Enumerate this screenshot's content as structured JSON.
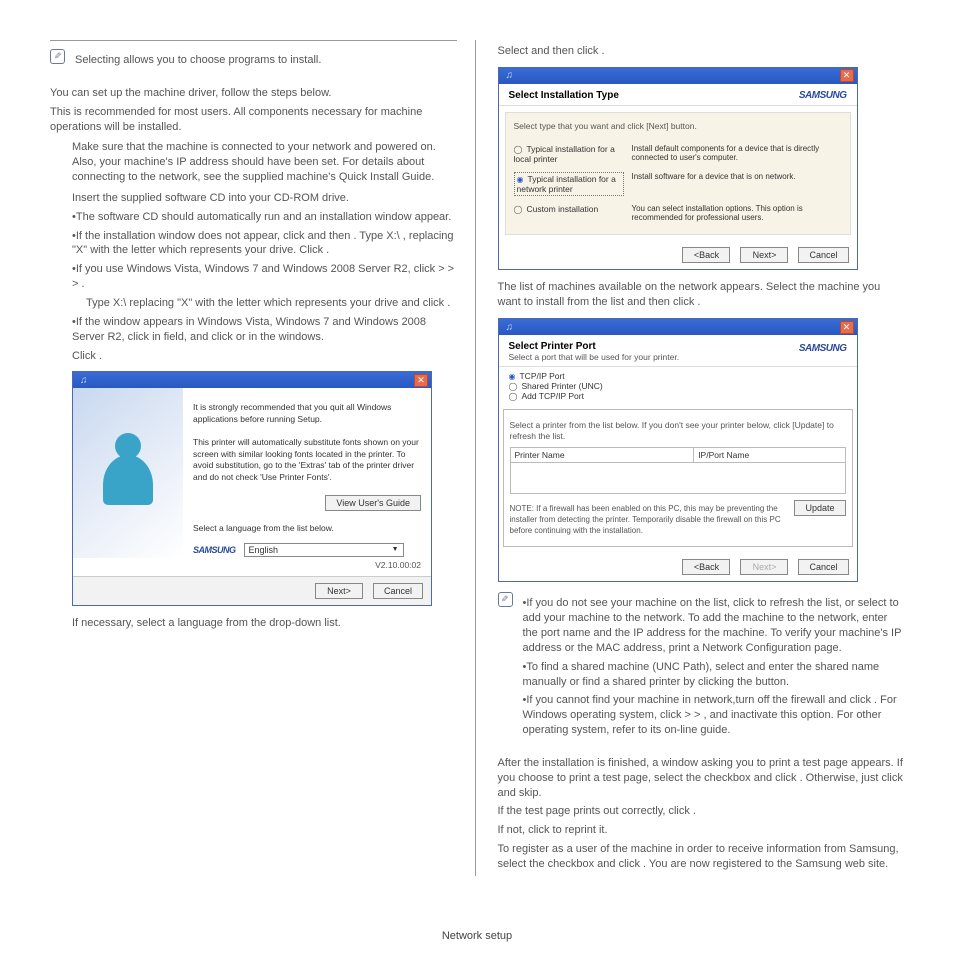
{
  "left": {
    "note1": "Selecting                    allows you to choose programs to install.",
    "p1": "You can set up the machine driver, follow the steps below.",
    "p2": "This is recommended for most users. All components necessary for machine operations will be installed.",
    "step1": "Make sure that the machine is connected to your network and powered on. Also, your machine's IP address should have been set. For details about connecting to the network, see the supplied machine's Quick Install Guide.",
    "step2": "Insert the supplied software CD into your CD-ROM drive.",
    "b1": "•The software CD should automatically run and an installation window appear.",
    "b2": "•If the installation window does not appear, click           and then           . Type X:\\               , replacing \"X\" with the letter which represents your drive. Click        .",
    "b3": "•If you use Windows Vista, Windows 7 and Windows 2008 Server R2, click           >                        >                        >        .",
    "b3b": "Type X:\\               replacing \"X\" with the letter which represents your drive and click        .",
    "b4": "•If the               window appears in Windows Vista, Windows 7 and Windows 2008 Server R2, click                              in                     field, and click               or        in the windows.",
    "clickNext": "Click        .",
    "dialog1": {
      "text1": "It is strongly recommended that you quit all Windows applications before running Setup.",
      "text2": "This printer will automatically substitute fonts shown on your screen with similar looking fonts located in the printer. To avoid substitution, go to the 'Extras' tab of the printer driver and do not check 'Use Printer Fonts'.",
      "viewGuide": "View User's Guide",
      "langPrompt": "Select a language from the list below.",
      "lang": "English",
      "version": "V2.10.00:02",
      "next": "Next>",
      "cancel": "Cancel",
      "samsung": "SAMSUNG"
    },
    "afterDialog": "If necessary, select a language from the drop-down list."
  },
  "right": {
    "topLine": "Select                                                      and then click        .",
    "dialog2": {
      "title": "Select Installation Type",
      "subtitle": "Select type that you want and click [Next] button.",
      "r1": "Typical installation for a local printer",
      "r1desc": "Install default components for a device that is directly connected to user's computer.",
      "r2": "Typical installation for a network printer",
      "r2desc": "Install software for a device that is on network.",
      "r3": "Custom installation",
      "r3desc": "You can select installation options. This option is recommended for professional users.",
      "back": "<Back",
      "next": "Next>",
      "cancel": "Cancel",
      "samsung": "SAMSUNG"
    },
    "midP": "The list of machines available on the network appears. Select the machine you want to install from the list and then click        .",
    "dialog3": {
      "title": "Select Printer Port",
      "subtitle": "Select a port that will be used for your printer.",
      "r1": "TCP/IP Port",
      "r2": "Shared Printer (UNC)",
      "r3": "Add TCP/IP Port",
      "groupNote": "Select a printer from the list below. If you don't see your printer below, click [Update] to refresh the list.",
      "th1": "Printer Name",
      "th2": "IP/Port Name",
      "note": "NOTE: If a firewall has been enabled on this PC, this may be preventing the installer from detecting the printer. Temporarily disable the firewall on this PC before continuing with the installation.",
      "update": "Update",
      "back": "<Back",
      "next": "Next>",
      "cancel": "Cancel",
      "samsung": "SAMSUNG"
    },
    "noteB1": "•If you do not see your machine on the list, click             to refresh the list, or select                                to add your machine to the network. To add the machine to the network, enter the port name and the IP address for the machine. To verify your machine's IP address or the MAC address, print a Network Configuration page.",
    "noteB2": "•To find a shared machine (UNC Path), select                              and enter the shared name manually or find a shared printer by clicking the               button.",
    "noteB3": "•If you cannot find your machine in network,turn off the firewall and click             . For Windows operating system, click           >                              >                              , and inactivate this option. For other operating system, refer to its on-line guide.",
    "after1": "After the installation is finished, a window asking you to print a test page appears. If you choose to print a test page, select the checkbox and click        . Otherwise, just click        and skip.",
    "after2": "If the test page prints out correctly, click        .",
    "after3": "If not, click        to reprint it.",
    "after4": "To register as a user of the machine in order to receive information from Samsung, select the checkbox and click             . You are now registered to the Samsung web site."
  },
  "footer": "Network setup"
}
